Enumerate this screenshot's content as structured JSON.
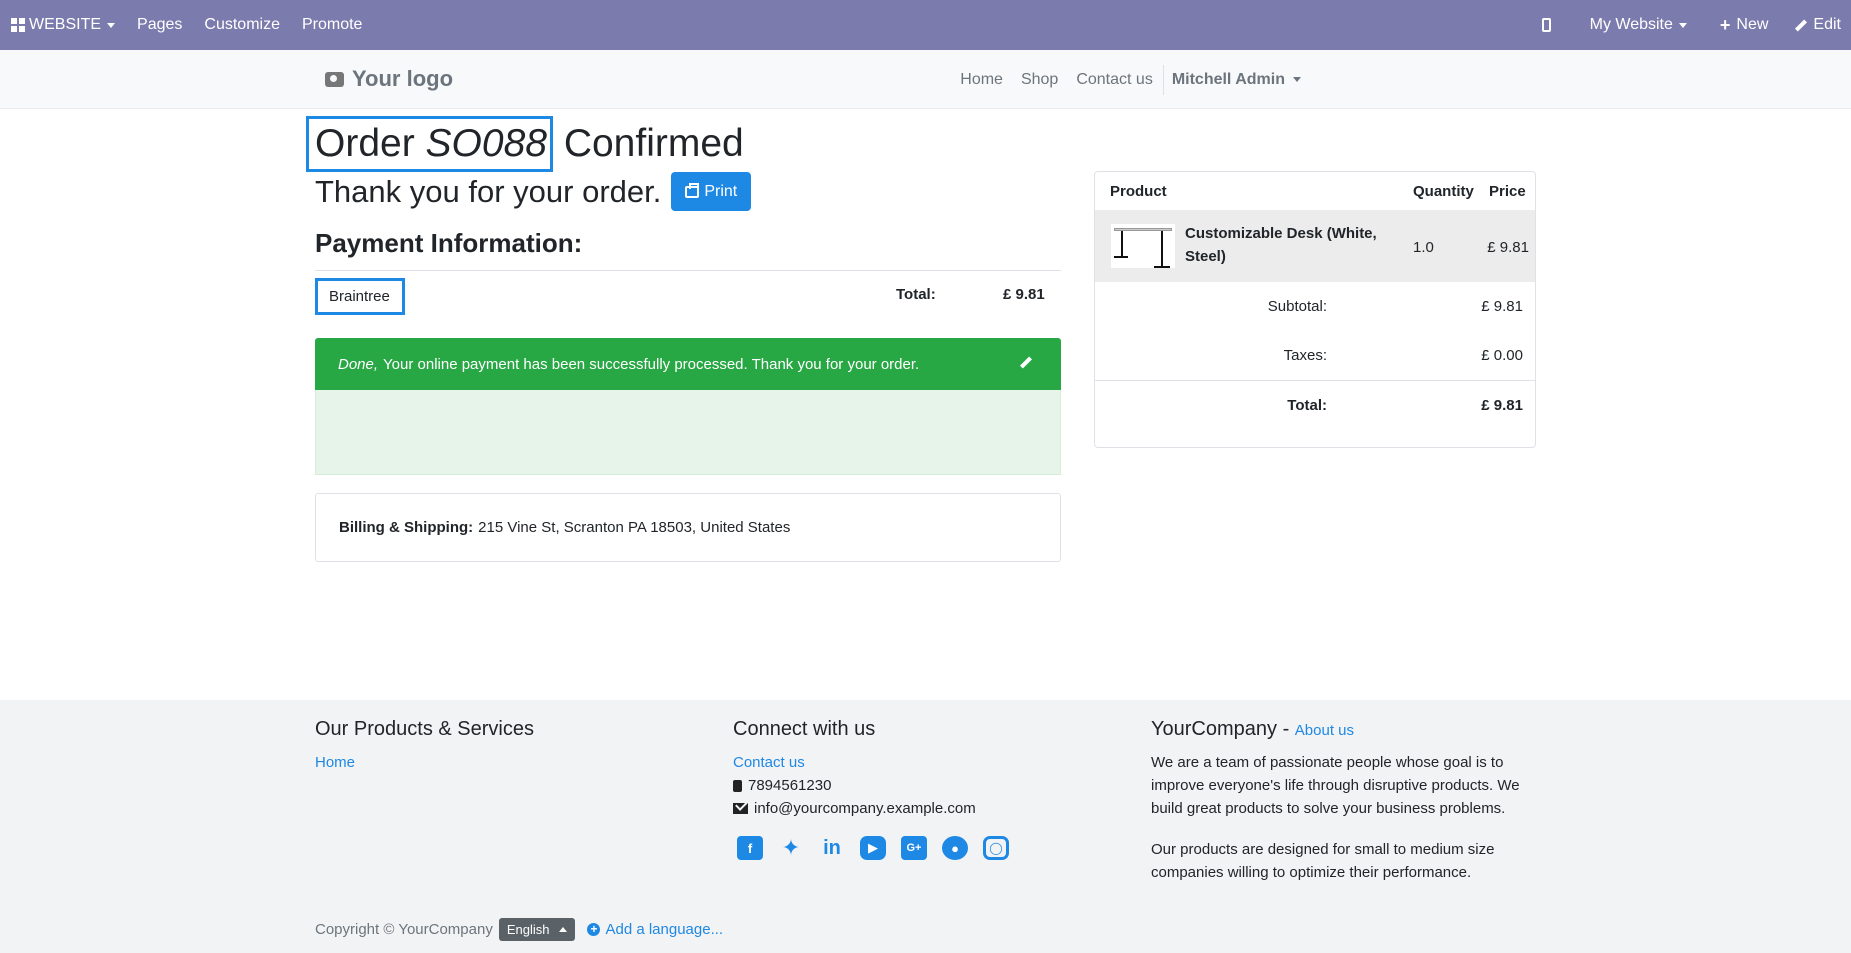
{
  "admin_bar": {
    "app_label": "WEBSITE",
    "menu": [
      "Pages",
      "Customize",
      "Promote"
    ],
    "website_selector": "My Website",
    "new_label": "New",
    "edit_label": "Edit"
  },
  "header": {
    "logo_text": "Your logo",
    "nav": [
      "Home",
      "Shop",
      "Contact us"
    ],
    "user": "Mitchell Admin"
  },
  "order": {
    "title_prefix": "Order",
    "number": "SO088",
    "title_suffix": "Confirmed",
    "thanks": "Thank you for your order.",
    "print_label": "Print",
    "payment_title": "Payment Information:",
    "payment_method": "Braintree",
    "total_label": "Total:",
    "total_value": "£ 9.81",
    "alert_done": "Done,",
    "alert_text": "Your online payment has been successfully processed. Thank you for your order.",
    "billing_label": "Billing & Shipping:",
    "billing_address": "215 Vine St, Scranton PA 18503, United States"
  },
  "summary": {
    "headers": [
      "Product",
      "Quantity",
      "Price"
    ],
    "product_name": "Customizable Desk (White, Steel)",
    "quantity": "1.0",
    "price": "£ 9.81",
    "subtotal_label": "Subtotal:",
    "subtotal_value": "£ 9.81",
    "taxes_label": "Taxes:",
    "taxes_value": "£ 0.00",
    "total_label": "Total:",
    "total_value": "£ 9.81"
  },
  "footer": {
    "col1_title": "Our Products & Services",
    "col1_link": "Home",
    "col2_title": "Connect with us",
    "col2_link": "Contact us",
    "phone": "7894561230",
    "email": "info@yourcompany.example.com",
    "socials": [
      "facebook-icon",
      "twitter-icon",
      "linkedin-icon",
      "youtube-icon",
      "google-plus-icon",
      "github-icon",
      "instagram-icon"
    ],
    "col3_company": "YourCompany",
    "col3_link": "About us",
    "about_p1": "We are a team of passionate people whose goal is to improve everyone's life through disruptive products. We build great products to solve your business problems.",
    "about_p2": "Our products are designed for small to medium size companies willing to optimize their performance.",
    "copyright": "Copyright © YourCompany",
    "language": "English",
    "add_language": "Add a language..."
  },
  "colors": {
    "admin_bar": "#7c7bad",
    "primary": "#1e88e5",
    "success": "#28a745"
  }
}
